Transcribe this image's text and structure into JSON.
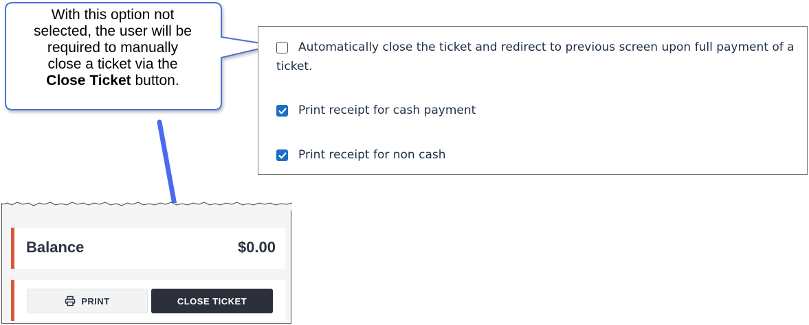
{
  "callout": {
    "line1": "With this option not",
    "line2": "selected, the user will be",
    "line3": "required to manually",
    "line4": "close a ticket via the",
    "bold_text": "Close Ticket",
    "tail_text": " button."
  },
  "settings": {
    "options": [
      {
        "label": "Automatically close the ticket and redirect to previous screen upon full payment of a ticket.",
        "checked": false
      },
      {
        "label": "Print receipt for cash payment",
        "checked": true
      },
      {
        "label": "Print receipt for non cash",
        "checked": true
      }
    ]
  },
  "ticket": {
    "balance_label": "Balance",
    "balance_value": "$0.00",
    "print_label": "PRINT",
    "close_label": "CLOSE TICKET",
    "accent_color": "#d9573e"
  },
  "colors": {
    "callout_border": "#4a6fdc",
    "arrow": "#4a6af0",
    "checkbox": "#1a6fc2"
  },
  "icons": {
    "print": "printer-icon",
    "check": "checkmark-icon"
  }
}
